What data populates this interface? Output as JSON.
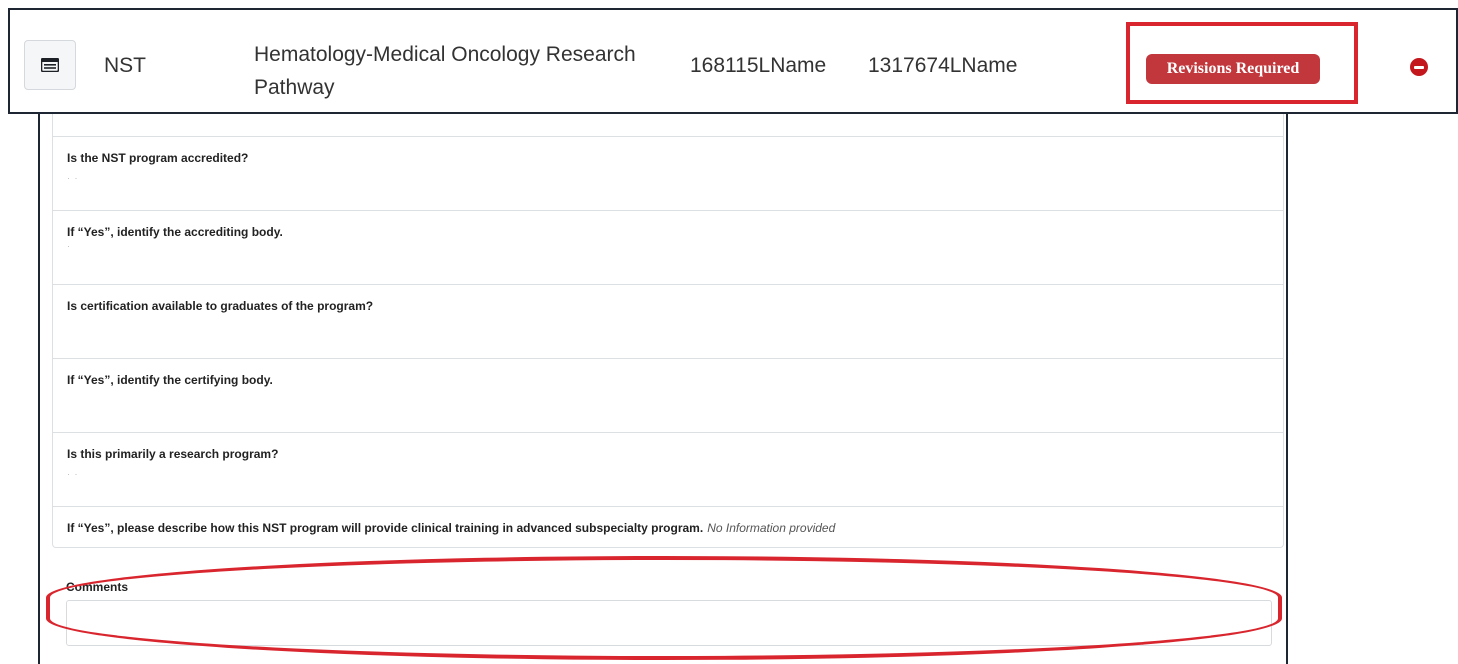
{
  "summary": {
    "type": "NST",
    "program": "Hematology-Medical Oncology Research Pathway",
    "id1": "168115LName",
    "id2": "1317674LName",
    "status": "Revisions Required",
    "view_icon": "document-list-icon",
    "remove_icon": "minus-circle-icon",
    "status_color": "#c2373c",
    "highlight_color": "#d9262e"
  },
  "questions": [
    {
      "label": "Is the NST program accredited?"
    },
    {
      "label": "If “Yes”, identify the accrediting body."
    },
    {
      "label": "Is certification available to graduates of the program?"
    },
    {
      "label": "If “Yes”, identify the certifying body."
    },
    {
      "label": "Is this primarily a research program?"
    },
    {
      "label": "If “Yes”, please describe how this NST program will provide clinical training in advanced subspecialty program.",
      "answer": "No Information provided"
    }
  ],
  "comments": {
    "label": "Comments",
    "value": ""
  }
}
